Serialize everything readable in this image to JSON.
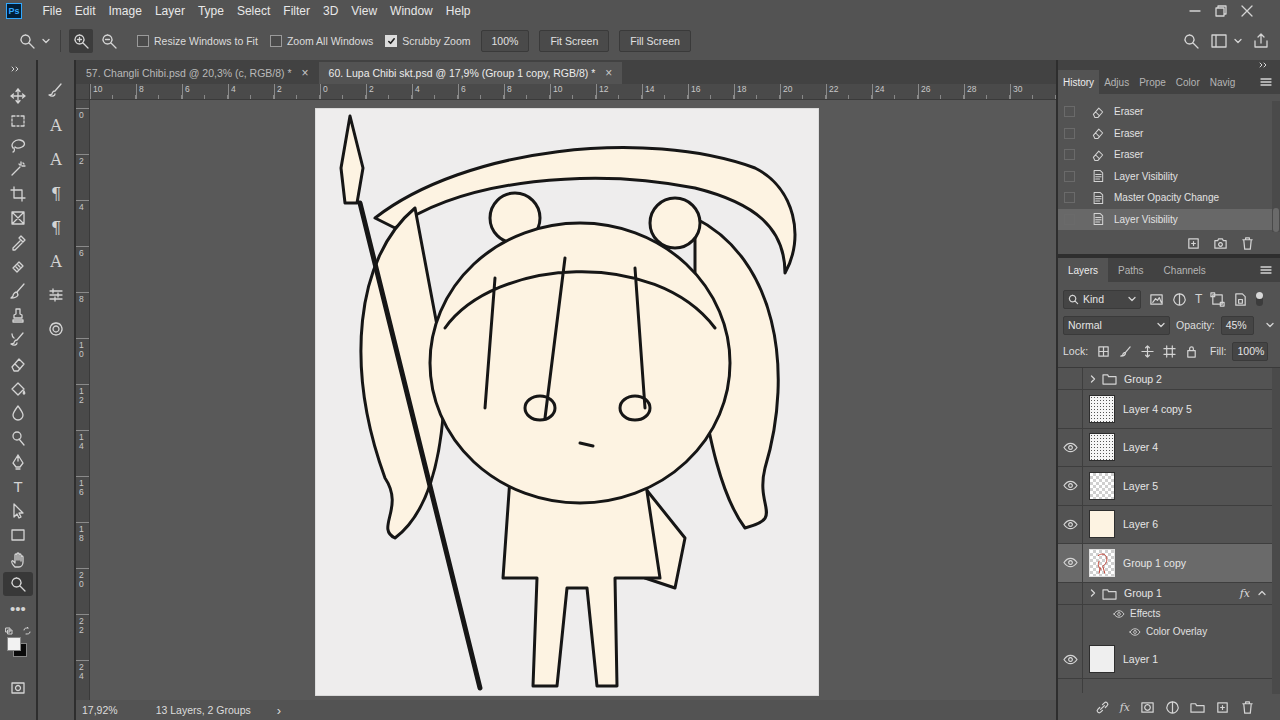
{
  "app": {
    "logo": "Ps"
  },
  "menu": [
    "File",
    "Edit",
    "Image",
    "Layer",
    "Type",
    "Select",
    "Filter",
    "3D",
    "View",
    "Window",
    "Help"
  ],
  "options": {
    "checkboxes": [
      {
        "label": "Resize Windows to Fit",
        "checked": false
      },
      {
        "label": "Zoom All Windows",
        "checked": false
      },
      {
        "label": "Scrubby Zoom",
        "checked": true
      }
    ],
    "zoom_level": "100%",
    "buttons": [
      "Fit Screen",
      "Fill Screen"
    ]
  },
  "documents": [
    {
      "label": "57. Changli Chibi.psd @ 20,3% (c, RGB/8) *",
      "selected": false
    },
    {
      "label": "60. Lupa Chibi skt.psd @ 17,9% (Group 1 copy, RGB/8) *",
      "selected": true
    }
  ],
  "close_glyph": "×",
  "rulers": {
    "horizontal": [
      "10",
      "8",
      "6",
      "4",
      "2",
      "0",
      "2",
      "4",
      "6",
      "8",
      "10",
      "12",
      "14",
      "16",
      "18",
      "20",
      "22",
      "24",
      "26",
      "28",
      "30"
    ],
    "vertical": [
      "0",
      "2",
      "4",
      "6",
      "8",
      "10",
      "12",
      "14",
      "16",
      "18",
      "20",
      "22",
      "24"
    ]
  },
  "tools": [
    {
      "kind": "icon",
      "selected": false
    },
    {
      "kind": "icon",
      "selected": false
    },
    {
      "kind": "icon",
      "selected": false
    },
    {
      "kind": "icon",
      "selected": false
    },
    {
      "kind": "icon",
      "selected": false
    },
    {
      "kind": "icon",
      "selected": false
    },
    {
      "kind": "icon",
      "selected": false
    },
    {
      "kind": "icon",
      "selected": false
    },
    {
      "kind": "icon",
      "selected": false
    },
    {
      "kind": "icon",
      "selected": false
    },
    {
      "kind": "icon",
      "selected": false
    },
    {
      "kind": "icon",
      "selected": false
    },
    {
      "kind": "icon",
      "selected": false
    },
    {
      "kind": "icon",
      "selected": false
    },
    {
      "kind": "icon",
      "selected": false
    },
    {
      "kind": "icon",
      "selected": false
    },
    {
      "kind": "glyph",
      "glyph": "T",
      "selected": false
    },
    {
      "kind": "icon",
      "selected": false
    },
    {
      "kind": "icon",
      "selected": false
    },
    {
      "kind": "icon",
      "selected": false
    },
    {
      "kind": "icon",
      "selected": true
    },
    {
      "kind": "glyph",
      "glyph": "•••",
      "selected": false
    }
  ],
  "dock": [
    {
      "kind": "icon"
    },
    {
      "kind": "glyph",
      "glyph": "A"
    },
    {
      "kind": "glyph",
      "glyph": "A"
    },
    {
      "kind": "glyph",
      "glyph": "¶"
    },
    {
      "kind": "glyph",
      "glyph": "¶"
    },
    {
      "kind": "glyph",
      "glyph": "A"
    },
    {
      "kind": "icon"
    },
    {
      "kind": "icon"
    }
  ],
  "swatches": {
    "foreground": "#f2f2f2",
    "background": "#0a0a0a"
  },
  "status_bar": {
    "zoom": "17,92%",
    "info": "13 Layers, 2 Groups",
    "arrow": "›"
  },
  "history": {
    "tabs": [
      {
        "label": "History",
        "selected": true
      },
      {
        "label": "Adjus",
        "selected": false
      },
      {
        "label": "Prope",
        "selected": false
      },
      {
        "label": "Color",
        "selected": false
      },
      {
        "label": "Navig",
        "selected": false
      }
    ],
    "items": [
      {
        "label": "Eraser",
        "kind": "eraser",
        "selected": false
      },
      {
        "label": "Eraser",
        "kind": "eraser",
        "selected": false
      },
      {
        "label": "Eraser",
        "kind": "eraser",
        "selected": false
      },
      {
        "label": "Layer Visibility",
        "kind": "state",
        "selected": false
      },
      {
        "label": "Master Opacity Change",
        "kind": "state",
        "selected": false
      },
      {
        "label": "Layer Visibility",
        "kind": "state",
        "selected": true
      }
    ]
  },
  "layers": {
    "tabs": [
      {
        "label": "Layers",
        "selected": true
      },
      {
        "label": "Paths",
        "selected": false
      },
      {
        "label": "Channels",
        "selected": false
      }
    ],
    "filter": {
      "label": "Kind",
      "type_glyph": "T",
      "enabled": true
    },
    "blend_mode": "Normal",
    "opacity": {
      "label": "Opacity:",
      "value": "45%"
    },
    "lock": {
      "label": "Lock:"
    },
    "fill": {
      "label": "Fill:",
      "value": "100%"
    },
    "items": [
      {
        "name": "Group 2",
        "kind": "group",
        "visible": false,
        "selected": false,
        "expanded": false
      },
      {
        "name": "Layer 4 copy 5",
        "kind": "layer",
        "thumb": "noise",
        "visible": false,
        "selected": false
      },
      {
        "name": "Layer 4",
        "kind": "layer",
        "thumb": "noise",
        "visible": true,
        "selected": false
      },
      {
        "name": "Layer 5",
        "kind": "layer",
        "thumb": "transparent",
        "visible": true,
        "selected": false
      },
      {
        "name": "Layer 6",
        "kind": "layer",
        "thumb": "cream",
        "visible": true,
        "selected": false
      },
      {
        "name": "Group 1 copy",
        "kind": "layer",
        "thumb": "sketch",
        "visible": true,
        "selected": true
      },
      {
        "name": "Group 1",
        "kind": "group",
        "visible": false,
        "selected": false,
        "expanded": false,
        "badge": "fx",
        "effects_expanded": true
      },
      {
        "name": "Effects",
        "kind": "effects",
        "visible": true,
        "selected": false
      },
      {
        "name": "Color Overlay",
        "kind": "effect",
        "visible": true,
        "selected": false
      },
      {
        "name": "Layer 1",
        "kind": "layer",
        "thumb": "white",
        "visible": true,
        "selected": false
      }
    ],
    "footer_fx": "fx"
  }
}
